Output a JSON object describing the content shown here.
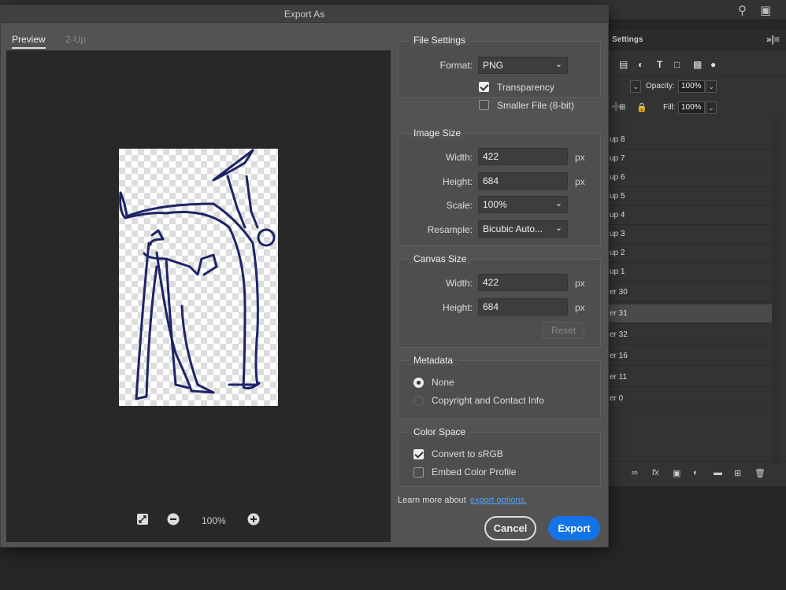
{
  "dialog": {
    "title": "Export As"
  },
  "tabs": {
    "preview": "Preview",
    "two_up": "2-Up"
  },
  "preview": {
    "zoom": "100%"
  },
  "file_settings": {
    "legend": "File Settings",
    "format_label": "Format:",
    "format_value": "PNG",
    "transparency_label": "Transparency",
    "transparency_checked": true,
    "smaller_file_label": "Smaller File (8-bit)",
    "smaller_file_checked": false
  },
  "image_size": {
    "legend": "Image Size",
    "width_label": "Width:",
    "width_value": "422",
    "height_label": "Height:",
    "height_value": "684",
    "scale_label": "Scale:",
    "scale_value": "100%",
    "resample_label": "Resample:",
    "resample_value": "Bicubic Auto...",
    "unit": "px"
  },
  "canvas_size": {
    "legend": "Canvas Size",
    "width_label": "Width:",
    "width_value": "422",
    "height_label": "Height:",
    "height_value": "684",
    "unit": "px",
    "reset_label": "Reset"
  },
  "metadata": {
    "legend": "Metadata",
    "options": [
      "None",
      "Copyright and Contact Info"
    ],
    "selected": "None"
  },
  "color_space": {
    "legend": "Color Space",
    "convert_label": "Convert to sRGB",
    "convert_checked": true,
    "embed_label": "Embed Color Profile",
    "embed_checked": false
  },
  "footer": {
    "learn_text": "Learn more about",
    "learn_link": "export options.",
    "cancel_label": "Cancel",
    "export_label": "Export"
  },
  "layers_panel": {
    "tab_label": "Settings",
    "menu": "»|≡",
    "opacity_label": "Opacity:",
    "opacity_value": "100%",
    "fill_label": "Fill:",
    "fill_value": "100%",
    "layers": [
      "up 8",
      "up 7",
      "up 6",
      "up 5",
      "up 4",
      "up 3",
      "up 2",
      "up 1",
      "er 30",
      "er 31",
      "er 32",
      "er 16",
      "er 11",
      "er 0"
    ],
    "selected_layer": "er 31"
  },
  "colors": {
    "accent": "#1473e6",
    "link": "#4fa3f7",
    "stroke": "#1d2466"
  }
}
